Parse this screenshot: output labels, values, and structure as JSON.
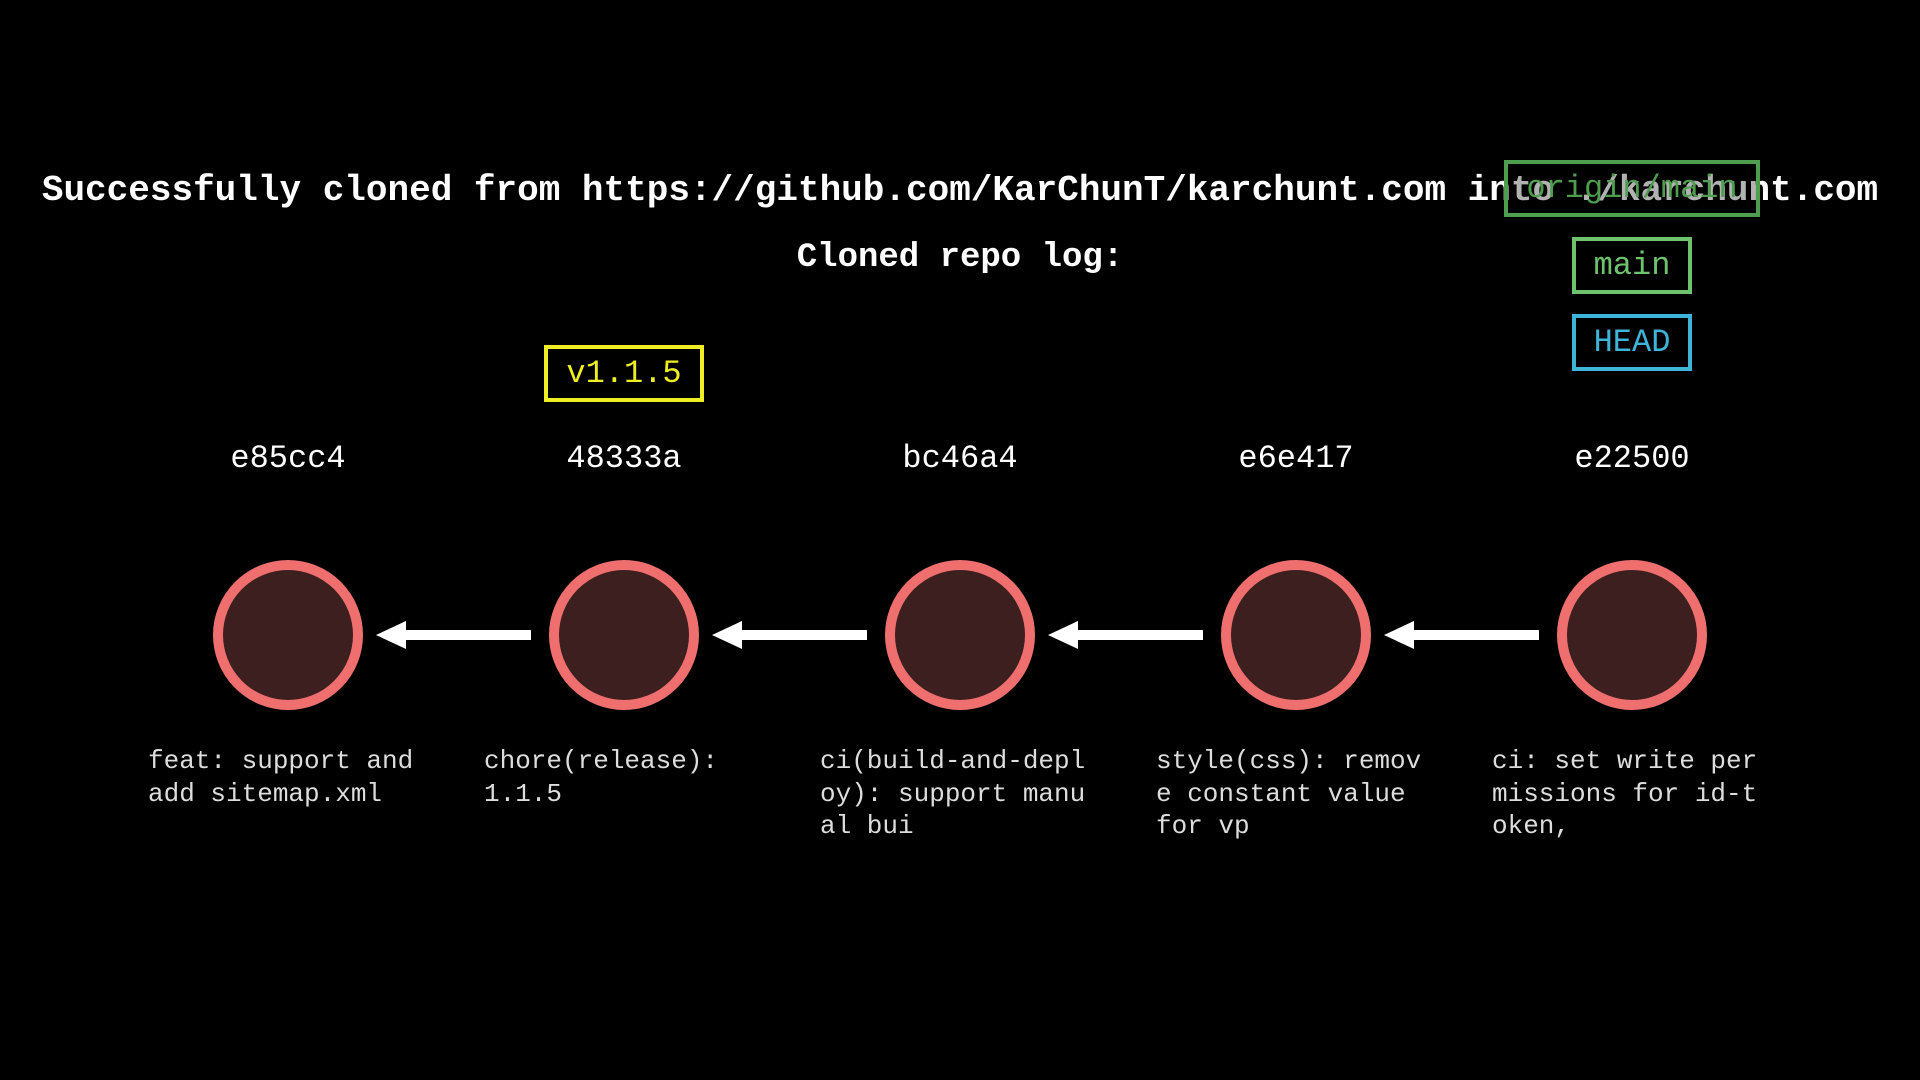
{
  "header": {
    "line1": "Successfully cloned from https://github.com/KarChunT/karchunt.com into ./karchunt.com",
    "line2": "Cloned repo log:"
  },
  "refs": {
    "remote": "origin/main",
    "local": "main",
    "head": "HEAD",
    "tag": "v1.1.5"
  },
  "commits": [
    {
      "hash": "e85cc4",
      "message": "feat: support and add sitemap.xml"
    },
    {
      "hash": "48333a",
      "message": "chore(release): 1.1.5"
    },
    {
      "hash": "bc46a4",
      "message": "ci(build-and-deploy): support manual bui"
    },
    {
      "hash": "e6e417",
      "message": "style(css): remove constant value for vp"
    },
    {
      "hash": "e22500",
      "message": "ci: set write permissions for id-token,"
    }
  ]
}
